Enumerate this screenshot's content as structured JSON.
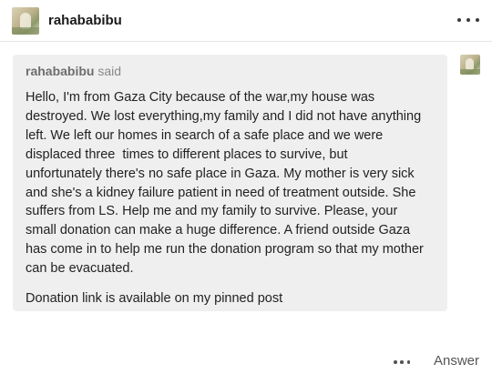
{
  "post": {
    "username": "rahababibu",
    "more_icon": "ellipsis-icon"
  },
  "ask": {
    "asker": "rahababibu",
    "said": "said",
    "paragraph_lines": [
      "Hello, I'm from Gaza City because of the war,my house was",
      "destroyed. We lost everything,my family and I did not have anything",
      "left. We left our homes in search of a safe place and we were",
      "displaced three  times to different places to survive, but",
      "unfortunately there's no safe place in Gaza. My mother is very sick",
      "and she's a kidney failure patient in need of treatment outside. She",
      "suffers from LS. Help me and my family to survive. Please, your",
      "small donation can make a huge difference. A friend outside Gaza",
      "has come in to help me run the donation program so that my mother",
      "can be evacuated."
    ],
    "paragraph_2": "Donation link is available on my pinned post"
  },
  "footer": {
    "answer_label": "Answer"
  },
  "colors": {
    "bubble_bg": "#efefef",
    "divider": "#e6e6e6"
  }
}
